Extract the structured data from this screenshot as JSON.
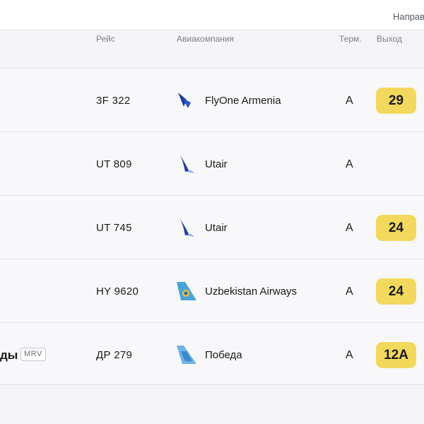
{
  "topbar": {
    "tab_label": "Направ"
  },
  "columns": {
    "flight": "Рейс",
    "airline": "Авиакомпания",
    "terminal": "Терм.",
    "gate": "Выход"
  },
  "rows": [
    {
      "flight": "3F 322",
      "airline": "FlyOne Armenia",
      "terminal": "A",
      "gate": "29",
      "logo": "flyone-logo"
    },
    {
      "flight": "UT 809",
      "airline": "Utair",
      "terminal": "A",
      "gate": "",
      "logo": "utair-logo"
    },
    {
      "flight": "UT 745",
      "airline": "Utair",
      "terminal": "A",
      "gate": "24",
      "logo": "utair-logo"
    },
    {
      "flight": "HY 9620",
      "airline": "Uzbekistan Airways",
      "terminal": "A",
      "gate": "24",
      "logo": "uzbekistan-airways-logo"
    },
    {
      "flight": "ДР 279",
      "airline": "Победа",
      "terminal": "A",
      "gate": "12A",
      "logo": "pobeda-logo",
      "destination_tail": "ды",
      "iata": "MRV"
    }
  ],
  "colors": {
    "gate_badge": "#f2d95d",
    "background": "#f5f5f7",
    "text": "#1a1a1a",
    "muted": "#7a7f8a"
  }
}
